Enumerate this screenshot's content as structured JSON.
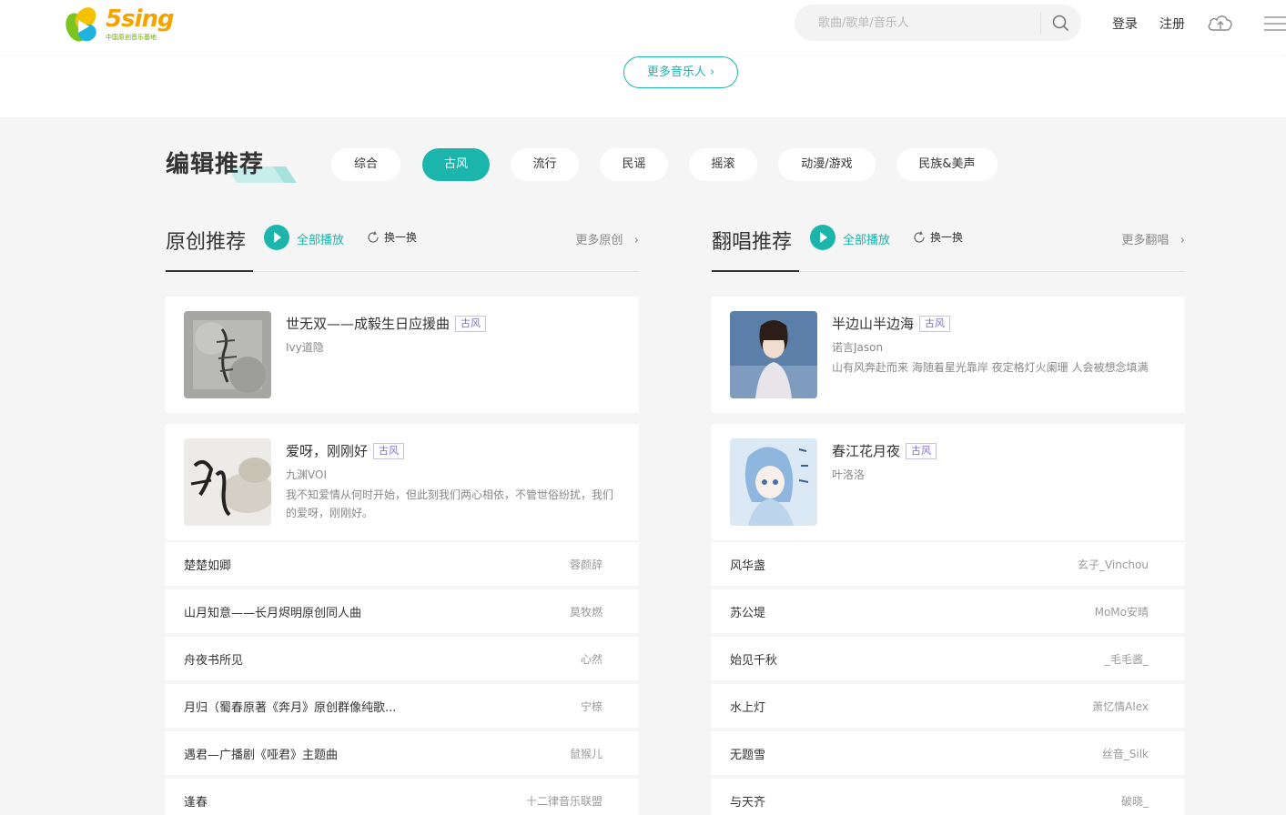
{
  "header": {
    "logo_text": "5sing",
    "logo_sub": "中国原创音乐基地",
    "search_placeholder": "歌曲/歌单/音乐人",
    "login": "登录",
    "register": "注册"
  },
  "more_artists": "更多音乐人",
  "editor": {
    "title": "编辑推荐",
    "genres": [
      "综合",
      "古风",
      "流行",
      "民谣",
      "摇滚",
      "动漫/游戏",
      "民族&美声"
    ],
    "active_genre": "古风"
  },
  "original": {
    "title": "原创推荐",
    "play_all": "全部播放",
    "refresh": "换一换",
    "more": "更多原创",
    "cards": [
      {
        "title": "世无双——成毅生日应援曲",
        "tag": "古风",
        "artist": "Ivy道隐",
        "desc": ""
      },
      {
        "title": "爱呀，刚刚好",
        "tag": "古风",
        "artist": "九渊VOI",
        "desc": "我不知爱情从何时开始，但此刻我们两心相依，不管世俗纷扰，我们的爱呀，刚刚好。"
      }
    ],
    "rows": [
      {
        "title": "楚楚如卿",
        "artist": "蓉颜辞"
      },
      {
        "title": "山月知意——长月烬明原创同人曲",
        "artist": "莫牧燃"
      },
      {
        "title": "舟夜书所见",
        "artist": "心然"
      },
      {
        "title": "月归（蜀春原著《奔月》原创群像纯歌...",
        "artist": "宁榇"
      },
      {
        "title": "遇君—广播剧《哑君》主题曲",
        "artist": "鼠猴儿"
      },
      {
        "title": "逢春",
        "artist": "十二律音乐联盟"
      }
    ]
  },
  "cover": {
    "title": "翻唱推荐",
    "play_all": "全部播放",
    "refresh": "换一换",
    "more": "更多翻唱",
    "cards": [
      {
        "title": "半边山半边海",
        "tag": "古风",
        "artist": "诺言Jason",
        "desc": "山有风奔赴而来 海随着星光靠岸 夜定格灯火阑珊 人会被想念填满"
      },
      {
        "title": "春江花月夜",
        "tag": "古风",
        "artist": "叶洛洛",
        "desc": ""
      }
    ],
    "rows": [
      {
        "title": "风华盏",
        "artist": "玄子_Vinchou"
      },
      {
        "title": "苏公堤",
        "artist": "MoMo安晴"
      },
      {
        "title": "始见千秋",
        "artist": "_毛毛酱_"
      },
      {
        "title": "水上灯",
        "artist": "萧忆情Alex"
      },
      {
        "title": "无题雪",
        "artist": "丝音_Silk"
      },
      {
        "title": "与天齐",
        "artist": "破晓_"
      }
    ]
  },
  "colors": {
    "accent": "#1bb5ac",
    "tag": "#7a6bd6",
    "background": "#f5f5f5"
  }
}
